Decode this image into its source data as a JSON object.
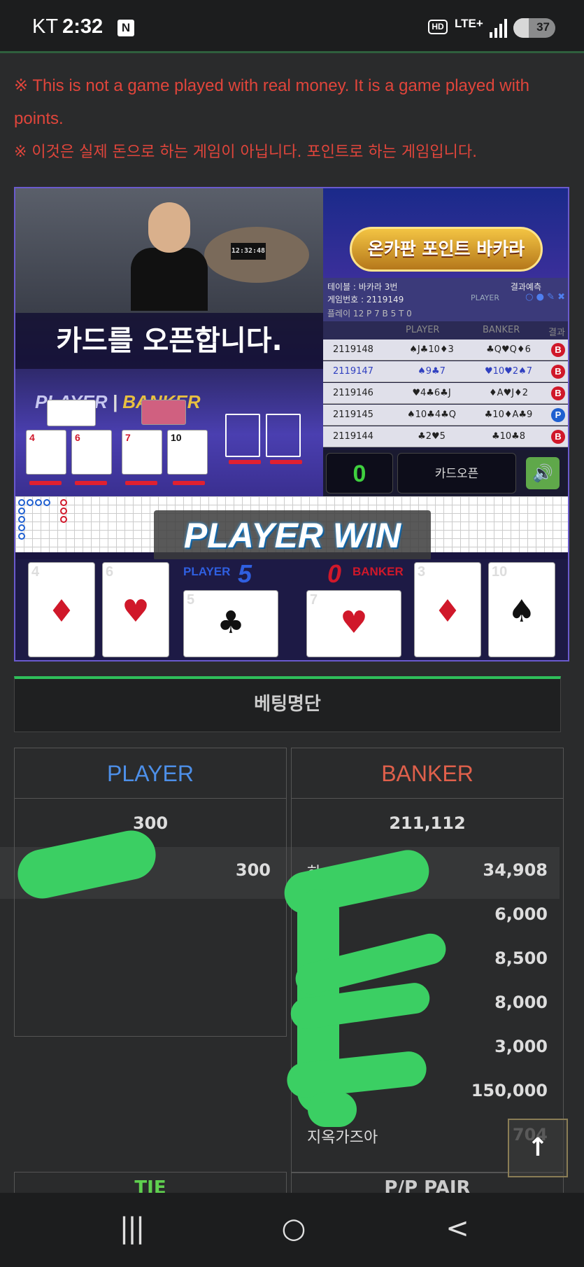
{
  "status_bar": {
    "carrier": "KT",
    "time": "2:32",
    "notification_icon": "N",
    "hd_badge": "HD",
    "network": "LTE+",
    "battery": "37",
    "battery_level": 0.37
  },
  "notices": {
    "english": "※ This is not a game played with real money. It is a game played with points.",
    "korean": "※ 이것은 실제 돈으로 하는 게임이 아닙니다. 포인트로 하는 게임입니다."
  },
  "game": {
    "video_timer": "12:32:48",
    "overlay_message": "카드를 오픈합니다.",
    "table_player_label": "PLAYER",
    "table_banker_label": "BANKER",
    "logo_text": "온카판 포인트 바카라",
    "info": {
      "table": "테이블 : 바카라 3번",
      "game_no": "게임번호 : 2119149",
      "stats": "플레이 12  P 7  B 5  T 0",
      "prediction": "결과예측",
      "prediction_player": "PLAYER",
      "prediction_banker": "BANKER"
    },
    "history_header": {
      "player": "PLAYER",
      "banker": "BANKER",
      "result": "결과"
    },
    "history": [
      {
        "id": "2119148",
        "player": "♠J♣10♦3",
        "banker": "♣Q♥Q♦6",
        "result": "B"
      },
      {
        "id": "2119147",
        "player": "♠9♣7",
        "banker": "♥10♥2♠7",
        "result": "B"
      },
      {
        "id": "2119146",
        "player": "♥4♣6♣J",
        "banker": "♦A♥J♦2",
        "result": "B"
      },
      {
        "id": "2119145",
        "player": "♠10♣4♣Q",
        "banker": "♣10♦A♣9",
        "result": "P"
      },
      {
        "id": "2119144",
        "player": "♣2♥5",
        "banker": "♣10♣8",
        "result": "B"
      }
    ],
    "counter": "0",
    "card_open_button": "카드오픈",
    "sound_icon": "speaker-icon",
    "win_banner": "PLAYER WIN",
    "player_label": "PLAYER",
    "player_score": "5",
    "banker_label": "BANKER",
    "banker_score": "0",
    "player_cards": [
      {
        "rank": "4",
        "suit": "♦",
        "color": "red"
      },
      {
        "rank": "6",
        "suit": "♥",
        "color": "red"
      },
      {
        "rank": "5",
        "suit": "♣",
        "color": "black"
      }
    ],
    "banker_cards": [
      {
        "rank": "7",
        "suit": "♥",
        "color": "red"
      },
      {
        "rank": "3",
        "suit": "♦",
        "color": "red"
      },
      {
        "rank": "10",
        "suit": "♠",
        "color": "black"
      }
    ]
  },
  "betting": {
    "title": "베팅명단",
    "player": {
      "header": "PLAYER",
      "total": "300",
      "rows": [
        {
          "name": "",
          "amount": "300"
        }
      ]
    },
    "banker": {
      "header": "BANKER",
      "total": "211,112",
      "rows": [
        {
          "name": "하",
          "amount": "34,908"
        },
        {
          "name": "",
          "amount": "6,000"
        },
        {
          "name": "",
          "amount": "8,500"
        },
        {
          "name": "",
          "amount": "8,000"
        },
        {
          "name": "",
          "amount": "3,000"
        },
        {
          "name": "",
          "amount": "150,000"
        },
        {
          "name": "지옥가즈아",
          "amount": "704"
        }
      ]
    },
    "tie_header": "TIE",
    "pp_header": "P/P PAIR"
  },
  "scroll_top_icon": "arrow-up-icon",
  "nav": {
    "recent": "|||",
    "home": "○",
    "back": "<"
  }
}
